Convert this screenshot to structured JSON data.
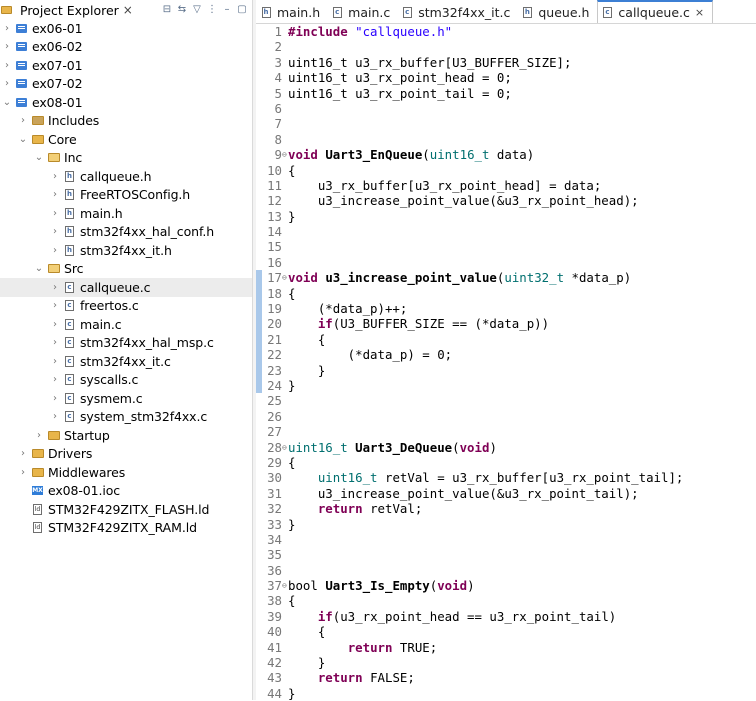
{
  "explorer": {
    "title": "Project Explorer",
    "close": "×",
    "tree": [
      {
        "label": "ex06-01",
        "depth": 0,
        "chev": "›",
        "icon": "proj"
      },
      {
        "label": "ex06-02",
        "depth": 0,
        "chev": "›",
        "icon": "proj"
      },
      {
        "label": "ex07-01",
        "depth": 0,
        "chev": "›",
        "icon": "proj"
      },
      {
        "label": "ex07-02",
        "depth": 0,
        "chev": "›",
        "icon": "proj"
      },
      {
        "label": "ex08-01",
        "depth": 0,
        "chev": "⌄",
        "icon": "proj"
      },
      {
        "label": "Includes",
        "depth": 1,
        "chev": "›",
        "icon": "includes"
      },
      {
        "label": "Core",
        "depth": 1,
        "chev": "⌄",
        "icon": "folder"
      },
      {
        "label": "Inc",
        "depth": 2,
        "chev": "⌄",
        "icon": "folder-open"
      },
      {
        "label": "callqueue.h",
        "depth": 3,
        "chev": "›",
        "icon": "h"
      },
      {
        "label": "FreeRTOSConfig.h",
        "depth": 3,
        "chev": "›",
        "icon": "h"
      },
      {
        "label": "main.h",
        "depth": 3,
        "chev": "›",
        "icon": "h"
      },
      {
        "label": "stm32f4xx_hal_conf.h",
        "depth": 3,
        "chev": "›",
        "icon": "h"
      },
      {
        "label": "stm32f4xx_it.h",
        "depth": 3,
        "chev": "›",
        "icon": "h"
      },
      {
        "label": "Src",
        "depth": 2,
        "chev": "⌄",
        "icon": "folder-open"
      },
      {
        "label": "callqueue.c",
        "depth": 3,
        "chev": "›",
        "icon": "c",
        "selected": true
      },
      {
        "label": "freertos.c",
        "depth": 3,
        "chev": "›",
        "icon": "c"
      },
      {
        "label": "main.c",
        "depth": 3,
        "chev": "›",
        "icon": "c"
      },
      {
        "label": "stm32f4xx_hal_msp.c",
        "depth": 3,
        "chev": "›",
        "icon": "c"
      },
      {
        "label": "stm32f4xx_it.c",
        "depth": 3,
        "chev": "›",
        "icon": "c"
      },
      {
        "label": "syscalls.c",
        "depth": 3,
        "chev": "›",
        "icon": "c"
      },
      {
        "label": "sysmem.c",
        "depth": 3,
        "chev": "›",
        "icon": "c"
      },
      {
        "label": "system_stm32f4xx.c",
        "depth": 3,
        "chev": "›",
        "icon": "c"
      },
      {
        "label": "Startup",
        "depth": 2,
        "chev": "›",
        "icon": "folder"
      },
      {
        "label": "Drivers",
        "depth": 1,
        "chev": "›",
        "icon": "folder"
      },
      {
        "label": "Middlewares",
        "depth": 1,
        "chev": "›",
        "icon": "folder"
      },
      {
        "label": "ex08-01.ioc",
        "depth": 1,
        "chev": "",
        "icon": "ioc"
      },
      {
        "label": "STM32F429ZITX_FLASH.ld",
        "depth": 1,
        "chev": "",
        "icon": "ld"
      },
      {
        "label": "STM32F429ZITX_RAM.ld",
        "depth": 1,
        "chev": "",
        "icon": "ld"
      }
    ]
  },
  "tabs": [
    {
      "label": "main.h",
      "icon": "h"
    },
    {
      "label": "main.c",
      "icon": "c"
    },
    {
      "label": "stm32f4xx_it.c",
      "icon": "c"
    },
    {
      "label": "queue.h",
      "icon": "h"
    },
    {
      "label": "callqueue.c",
      "icon": "c",
      "active": true,
      "close": "×"
    }
  ],
  "code": [
    {
      "n": "1",
      "t": [
        [
          "kw",
          "#include "
        ],
        [
          "str",
          "\"callqueue.h\""
        ]
      ]
    },
    {
      "n": "2",
      "t": []
    },
    {
      "n": "3",
      "t": [
        [
          "",
          "uint16_t u3_rx_buffer[U3_BUFFER_SIZE];"
        ]
      ]
    },
    {
      "n": "4",
      "t": [
        [
          "",
          "uint16_t u3_rx_point_head = 0;"
        ]
      ]
    },
    {
      "n": "5",
      "t": [
        [
          "",
          "uint16_t u3_rx_point_tail = 0;"
        ]
      ]
    },
    {
      "n": "6",
      "t": []
    },
    {
      "n": "7",
      "t": []
    },
    {
      "n": "8",
      "t": []
    },
    {
      "n": "9",
      "fold": true,
      "t": [
        [
          "kw",
          "void "
        ],
        [
          "fn",
          "Uart3_EnQueue"
        ],
        [
          "",
          "("
        ],
        [
          "ty",
          "uint16_t"
        ],
        [
          "",
          " data)"
        ]
      ]
    },
    {
      "n": "10",
      "t": [
        [
          "",
          "{"
        ]
      ]
    },
    {
      "n": "11",
      "t": [
        [
          "",
          "    u3_rx_buffer[u3_rx_point_head] = data;"
        ]
      ]
    },
    {
      "n": "12",
      "t": [
        [
          "",
          "    u3_increase_point_value(&u3_rx_point_head);"
        ]
      ]
    },
    {
      "n": "13",
      "t": [
        [
          "",
          "}"
        ]
      ]
    },
    {
      "n": "14",
      "t": []
    },
    {
      "n": "15",
      "t": []
    },
    {
      "n": "16",
      "t": []
    },
    {
      "n": "17",
      "fold": true,
      "mark": true,
      "t": [
        [
          "kw",
          "void "
        ],
        [
          "fn",
          "u3_increase_point_value"
        ],
        [
          "",
          "("
        ],
        [
          "ty",
          "uint32_t"
        ],
        [
          "",
          " *data_p)"
        ]
      ]
    },
    {
      "n": "18",
      "mark": true,
      "t": [
        [
          "",
          "{"
        ]
      ]
    },
    {
      "n": "19",
      "mark": true,
      "t": [
        [
          "",
          "    (*data_p)++;"
        ]
      ]
    },
    {
      "n": "20",
      "mark": true,
      "t": [
        [
          "",
          "    "
        ],
        [
          "kw",
          "if"
        ],
        [
          "",
          "(U3_BUFFER_SIZE == (*data_p))"
        ]
      ]
    },
    {
      "n": "21",
      "mark": true,
      "t": [
        [
          "",
          "    {"
        ]
      ]
    },
    {
      "n": "22",
      "mark": true,
      "t": [
        [
          "",
          "        (*data_p) = 0;"
        ]
      ]
    },
    {
      "n": "23",
      "mark": true,
      "t": [
        [
          "",
          "    }"
        ]
      ]
    },
    {
      "n": "24",
      "mark": true,
      "t": [
        [
          "",
          "}"
        ]
      ]
    },
    {
      "n": "25",
      "t": []
    },
    {
      "n": "26",
      "t": []
    },
    {
      "n": "27",
      "t": []
    },
    {
      "n": "28",
      "fold": true,
      "t": [
        [
          "ty",
          "uint16_t "
        ],
        [
          "fn",
          "Uart3_DeQueue"
        ],
        [
          "",
          "("
        ],
        [
          "kw",
          "void"
        ],
        [
          "",
          ")"
        ]
      ]
    },
    {
      "n": "29",
      "t": [
        [
          "",
          "{"
        ]
      ]
    },
    {
      "n": "30",
      "t": [
        [
          "",
          "    "
        ],
        [
          "ty",
          "uint16_t"
        ],
        [
          "",
          " retVal = u3_rx_buffer[u3_rx_point_tail];"
        ]
      ]
    },
    {
      "n": "31",
      "t": [
        [
          "",
          "    u3_increase_point_value(&u3_rx_point_tail);"
        ]
      ]
    },
    {
      "n": "32",
      "t": [
        [
          "",
          "    "
        ],
        [
          "kw",
          "return"
        ],
        [
          "",
          " retVal;"
        ]
      ]
    },
    {
      "n": "33",
      "t": [
        [
          "",
          "}"
        ]
      ]
    },
    {
      "n": "34",
      "t": []
    },
    {
      "n": "35",
      "t": []
    },
    {
      "n": "36",
      "t": []
    },
    {
      "n": "37",
      "fold": true,
      "t": [
        [
          "",
          "bool "
        ],
        [
          "fn",
          "Uart3_Is_Empty"
        ],
        [
          "",
          "("
        ],
        [
          "kw",
          "void"
        ],
        [
          "",
          ")"
        ]
      ]
    },
    {
      "n": "38",
      "t": [
        [
          "",
          "{"
        ]
      ]
    },
    {
      "n": "39",
      "t": [
        [
          "",
          "    "
        ],
        [
          "kw",
          "if"
        ],
        [
          "",
          "(u3_rx_point_head == u3_rx_point_tail)"
        ]
      ]
    },
    {
      "n": "40",
      "t": [
        [
          "",
          "    {"
        ]
      ]
    },
    {
      "n": "41",
      "t": [
        [
          "",
          "        "
        ],
        [
          "kw",
          "return"
        ],
        [
          "",
          " TRUE;"
        ]
      ]
    },
    {
      "n": "42",
      "t": [
        [
          "",
          "    }"
        ]
      ]
    },
    {
      "n": "43",
      "t": [
        [
          "",
          "    "
        ],
        [
          "kw",
          "return"
        ],
        [
          "",
          " FALSE;"
        ]
      ]
    },
    {
      "n": "44",
      "t": [
        [
          "",
          "}"
        ]
      ]
    }
  ]
}
